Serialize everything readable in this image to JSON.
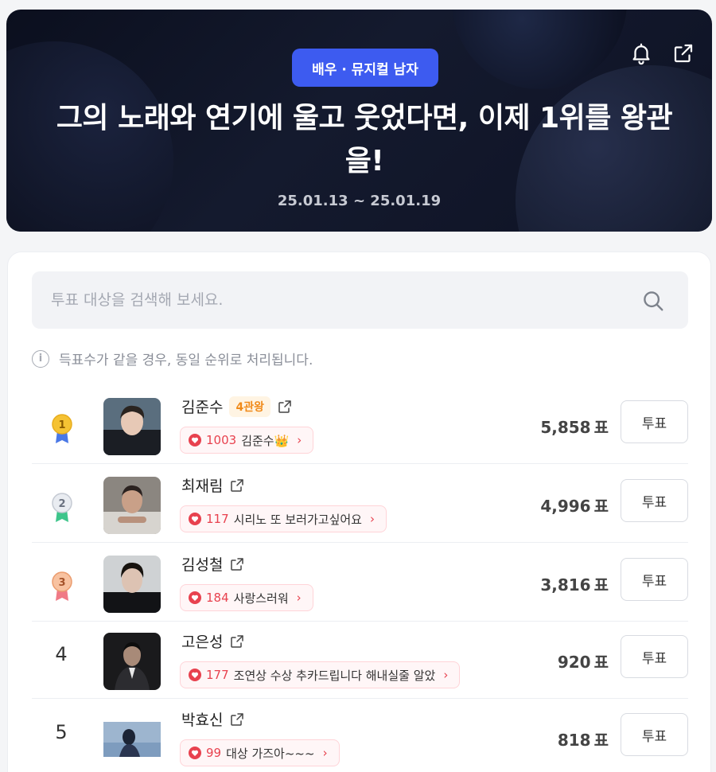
{
  "header": {
    "category_badge": "배우 · 뮤지컬 남자",
    "title": "그의 노래와 연기에 울고 웃었다면, 이제 1위를 왕관을!",
    "date_range": "25.01.13 ~ 25.01.19",
    "icons": [
      "bell-icon",
      "share-icon"
    ]
  },
  "search": {
    "placeholder": "투표 대상을 검색해 보세요.",
    "value": ""
  },
  "notice": {
    "text": "득표수가 같을 경우, 동일 순위로 처리됩니다."
  },
  "vote_unit": "표",
  "vote_button_label": "투표",
  "rankings": [
    {
      "rank": "1",
      "name": "김준수",
      "badge": "4관왕",
      "cheer_count": "1003",
      "cheer_text": "김준수👑",
      "votes": "5,858",
      "medal_color": "#f5c233"
    },
    {
      "rank": "2",
      "name": "최재림",
      "badge": "",
      "cheer_count": "117",
      "cheer_text": "시리노 또 보러가고싶어요",
      "votes": "4,996",
      "medal_color": "#c9ced8"
    },
    {
      "rank": "3",
      "name": "김성철",
      "badge": "",
      "cheer_count": "184",
      "cheer_text": "사랑스러워",
      "votes": "3,816",
      "medal_color": "#f2a77a"
    },
    {
      "rank": "4",
      "name": "고은성",
      "badge": "",
      "cheer_count": "177",
      "cheer_text": "조연상 수상 추카드립니다 해내실줄 알았",
      "votes": "920"
    },
    {
      "rank": "5",
      "name": "박효신",
      "badge": "",
      "cheer_count": "99",
      "cheer_text": "대상 가즈아~~~",
      "votes": "818"
    }
  ]
}
